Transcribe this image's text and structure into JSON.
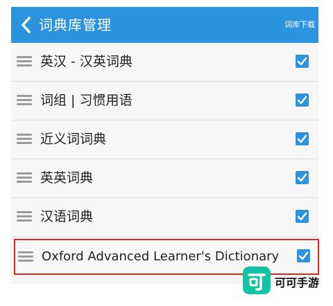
{
  "header": {
    "title": "词典库管理",
    "action_label": "词库下载"
  },
  "dictionaries": [
    {
      "label": "英汉 - 汉英词典",
      "checked": true
    },
    {
      "label": "词组 | 习惯用语",
      "checked": true
    },
    {
      "label": "近义词词典",
      "checked": true
    },
    {
      "label": "英英词典",
      "checked": true
    },
    {
      "label": "汉语词典",
      "checked": true
    },
    {
      "label": "Oxford Advanced Learner's Dictionary",
      "checked": true,
      "highlighted": true
    }
  ],
  "watermark": {
    "text": "可可手游"
  },
  "colors": {
    "accent": "#2c93de",
    "highlight_border": "#d42a2a",
    "watermark_logo": "#11c4a3"
  },
  "icons": {
    "back": "chevron-left-icon",
    "drag": "drag-handle-icon",
    "check": "checkbox-checked-icon"
  }
}
